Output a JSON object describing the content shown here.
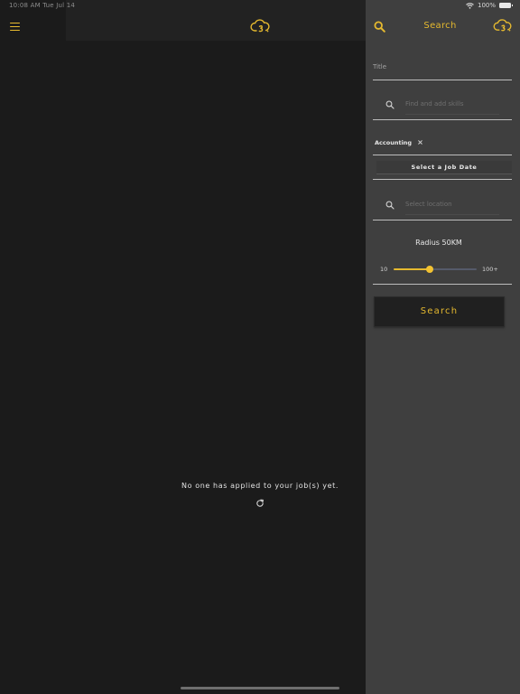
{
  "status_bar": {
    "time": "10:08 AM Tue Jul 14",
    "battery": "100%"
  },
  "main": {
    "empty_message": "No one has applied to your job(s) yet."
  },
  "search_panel": {
    "title": "Search",
    "title_field_label": "Title",
    "skills_placeholder": "Find and add skills",
    "selected_skill": "Accounting",
    "date_button_label": "Select a Job Date",
    "location_placeholder": "Select location",
    "radius_label": "Radius 50KM",
    "slider_min_label": "10",
    "slider_max_label": "100+",
    "radius_fraction": 0.44,
    "search_button_label": "Search"
  },
  "icons": {
    "menu": "menu-icon",
    "logo": "brand-logo",
    "search": "search-icon",
    "refresh": "refresh-icon",
    "wifi": "wifi-icon",
    "battery": "battery-icon"
  },
  "colors": {
    "accent": "#e5b92f",
    "main_background": "#1b1b1b",
    "panel_background": "#3f3f3f",
    "button_background": "#202020"
  }
}
